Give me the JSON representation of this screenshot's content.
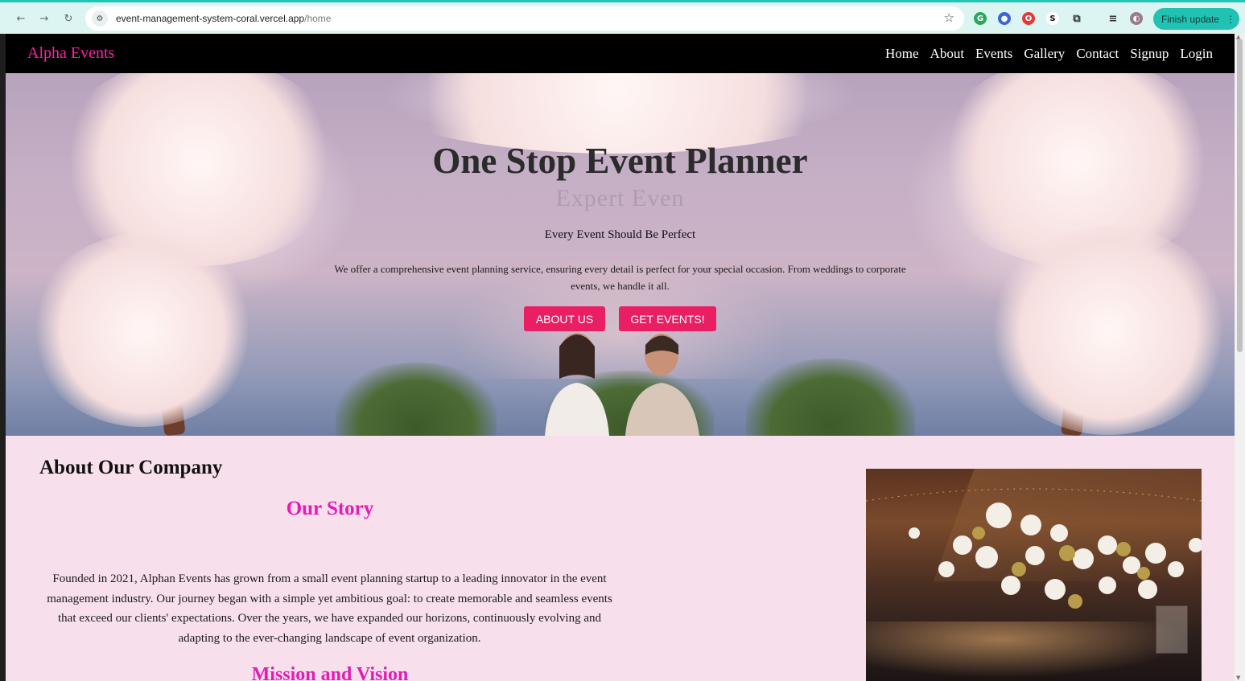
{
  "browser": {
    "url_host": "event-management-system-coral.vercel.app",
    "url_path": "/home",
    "finish_update_label": "Finish update"
  },
  "site": {
    "brand": "Alpha Events",
    "nav": [
      "Home",
      "About",
      "Events",
      "Gallery",
      "Contact",
      "Signup",
      "Login"
    ]
  },
  "hero": {
    "title": "One Stop Event Planner",
    "ghost_text": "Expert Even",
    "subtitle": "Every Event Should Be Perfect",
    "description": "We offer a comprehensive event planning service, ensuring every detail is perfect for your special occasion. From weddings to corporate events, we handle it all.",
    "buttons": [
      "ABOUT US",
      "GET EVENTS!"
    ]
  },
  "about": {
    "heading": "About Our Company",
    "story_heading": "Our Story",
    "story_text": "Founded in 2021, Alphan Events has grown from a small event planning startup to a leading innovator in the event management industry. Our journey began with a simple yet ambitious goal: to create memorable and seamless events that exceed our clients' expectations. Over the years, we have expanded our horizons, continuously evolving and adapting to the ever-changing landscape of event organization.",
    "mission_heading": "Mission and Vision"
  },
  "colors": {
    "brand_pink": "#ff1fa8",
    "button_pink": "#e91e63",
    "heading_magenta": "#e41bb5",
    "page_bg": "#f7dfec",
    "chrome_accent": "#20c5b6"
  },
  "icons": [
    "back-icon",
    "forward-icon",
    "reload-icon",
    "site-info-icon",
    "bookmark-star-icon",
    "extensions-icon",
    "more-icon"
  ]
}
